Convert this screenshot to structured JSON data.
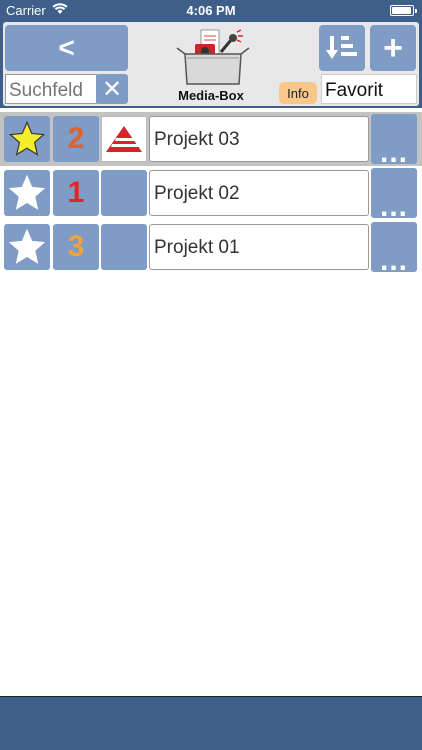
{
  "status_bar": {
    "carrier": "Carrier",
    "time": "4:06 PM"
  },
  "header": {
    "back_label": "<",
    "search_placeholder": "Suchfeld",
    "clear_label": "✕",
    "logo_label": "Media-Box",
    "add_label": "+",
    "info_label": "Info",
    "favorit_label": "Favorit"
  },
  "colors": {
    "bar_blue": "#3e5f8a",
    "button_blue": "#7e9cc6",
    "star_active": "#f5ee2a",
    "rank_2": "#e0622b",
    "rank_1": "#e02626",
    "rank_3": "#f2a23a"
  },
  "projects": [
    {
      "rank": "2",
      "name": "Projekt 03",
      "favorite": true,
      "selected": true,
      "more_label": "..."
    },
    {
      "rank": "1",
      "name": "Projekt 02",
      "favorite": false,
      "selected": false,
      "more_label": "..."
    },
    {
      "rank": "3",
      "name": "Projekt 01",
      "favorite": false,
      "selected": false,
      "more_label": "..."
    }
  ]
}
